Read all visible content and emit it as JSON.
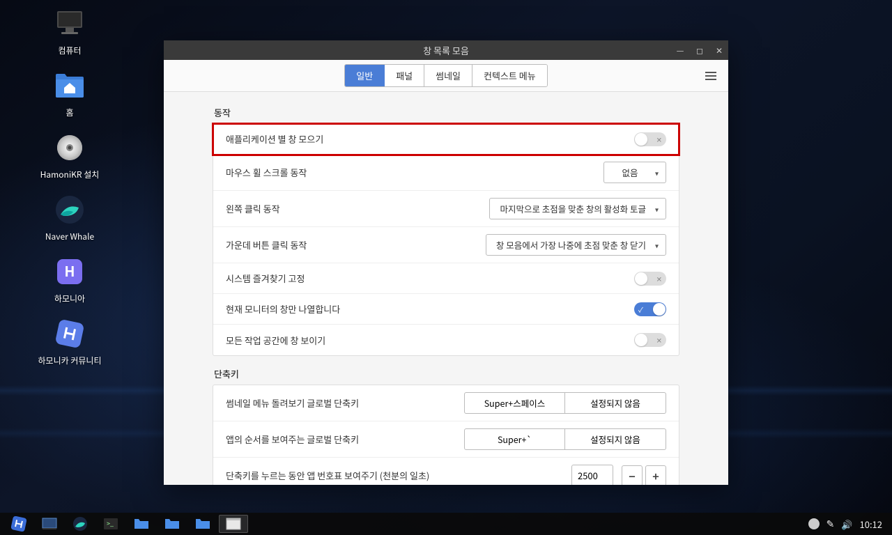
{
  "desktop": {
    "icons": [
      {
        "label": "컴퓨터"
      },
      {
        "label": "홈"
      },
      {
        "label": "HamoniKR 설치"
      },
      {
        "label": "Naver Whale"
      },
      {
        "label": "하모니아"
      },
      {
        "label": "하모니카 커뮤니티"
      }
    ]
  },
  "window": {
    "title": "창 목록 모음",
    "tabs": [
      "일반",
      "패널",
      "썸네일",
      "컨텍스트 메뉴"
    ],
    "sections": {
      "behavior": {
        "title": "동작",
        "rows": {
          "group_by_app": "애플리케이션 별 창 모으기",
          "mouse_wheel": "마우스 휠 스크롤 동작",
          "mouse_wheel_value": "없음",
          "left_click": "왼쪽 클릭 동작",
          "left_click_value": "마지막으로 초점을 맞춘 창의 활성화 토글",
          "middle_click": "가운데 버튼 클릭 동작",
          "middle_click_value": "창 모음에서 가장 나중에 초점 맞춘 창 닫기",
          "pin_favorites": "시스템 즐겨찾기 고정",
          "current_monitor": "현재 모니터의 창만 나열합니다",
          "all_workspaces": "모든 작업 공간에 창 보이기"
        }
      },
      "shortcuts": {
        "title": "단축키",
        "rows": {
          "thumbnail_menu": "썸네일 메뉴 돌려보기 글로벌 단축키",
          "thumbnail_key1": "Super+스페이스",
          "thumbnail_key2": "설정되지 않음",
          "app_order": "앱의 순서를 보여주는 글로벌 단축키",
          "app_order_key1": "Super+`",
          "app_order_key2": "설정되지 않음",
          "show_number": "단축키를 누르는 동안 앱 번호표 보여주기 (천분의 일초)",
          "show_number_value": "2500"
        }
      }
    }
  },
  "taskbar": {
    "clock": "10:12"
  }
}
